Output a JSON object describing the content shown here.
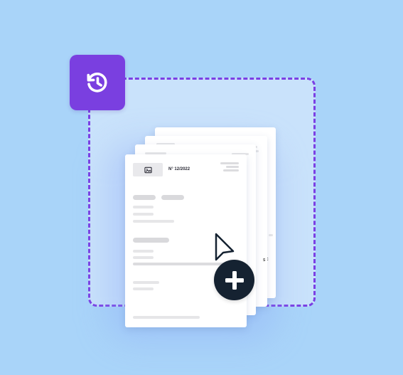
{
  "document": {
    "number_label": "N° 12/2022"
  },
  "back_sheet_marks": {
    "s3_mark": "S",
    "s4_mark": "C"
  },
  "icons": {
    "history": "history-clock-icon",
    "image": "image-icon",
    "cursor": "cursor-icon",
    "plus": "plus-icon"
  },
  "colors": {
    "background": "#a9d4f9",
    "dropzone_fill": "#c9e2fb",
    "dropzone_border": "#7b3fe4",
    "history_button": "#7a3fe0",
    "add_button": "#152231",
    "sheet": "#ffffff"
  }
}
